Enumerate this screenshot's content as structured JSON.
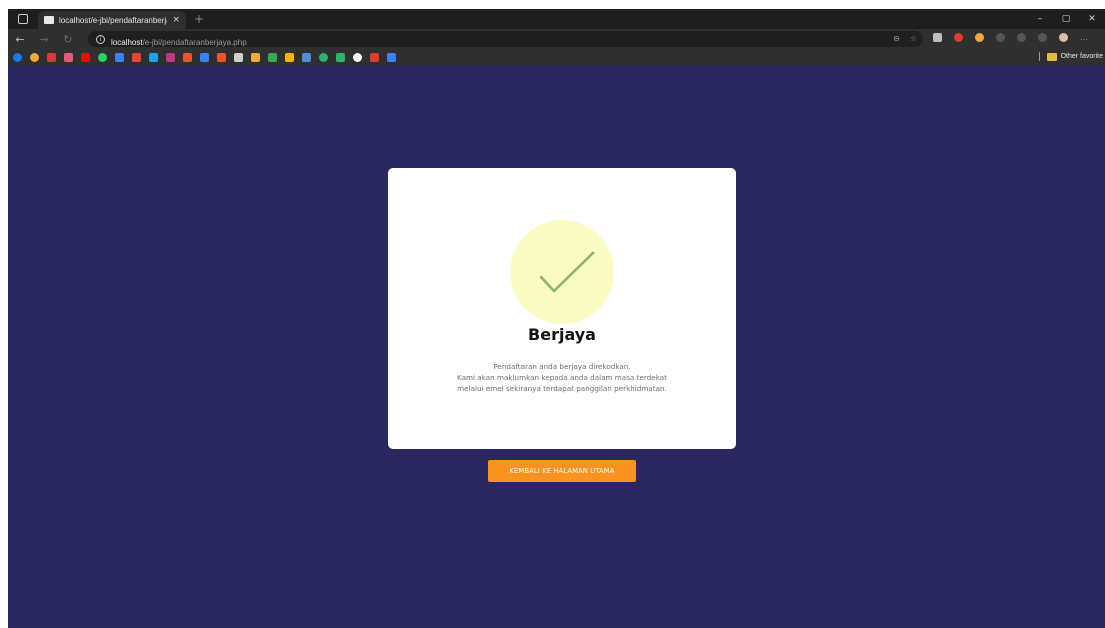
{
  "browser": {
    "tab": {
      "title": "localhost/e-jbi/pendaftaranberja",
      "close": "×"
    },
    "new_tab": "+",
    "window_controls": [
      "–",
      "▢",
      "✕"
    ],
    "address": {
      "host": "localhost",
      "path": "/e-jbi/pendaftaranberjaya.php"
    },
    "bookmarks": {
      "other_favorites": "Other favorite"
    }
  },
  "card": {
    "title": "Berjaya",
    "lines": [
      "Pendaftaran anda berjaya direkodkan.",
      "Kami akan maklumkan kepada anda dalam masa terdekat",
      "melalui emel sekiranya terdapat panggilan perkhidmatan."
    ]
  },
  "button": {
    "label": "KEMBALI KE HALAMAN UTAMA"
  },
  "colors": {
    "page_background": "#2a2660",
    "card_background": "#ffffff",
    "check_circle": "#fbfcc4",
    "check_mark": "#8bb66a",
    "button": "#f7931e"
  }
}
